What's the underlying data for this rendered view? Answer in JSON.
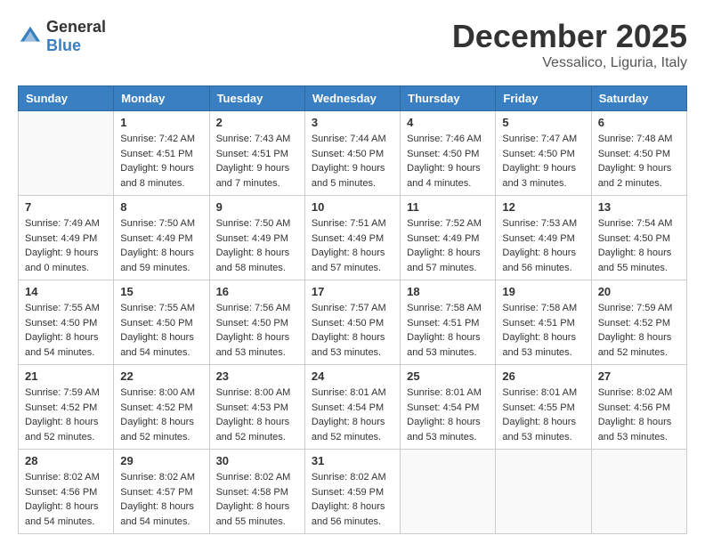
{
  "header": {
    "logo_general": "General",
    "logo_blue": "Blue",
    "month": "December 2025",
    "location": "Vessalico, Liguria, Italy"
  },
  "days_of_week": [
    "Sunday",
    "Monday",
    "Tuesday",
    "Wednesday",
    "Thursday",
    "Friday",
    "Saturday"
  ],
  "weeks": [
    [
      {
        "day": "",
        "sunrise": "",
        "sunset": "",
        "daylight": ""
      },
      {
        "day": "1",
        "sunrise": "Sunrise: 7:42 AM",
        "sunset": "Sunset: 4:51 PM",
        "daylight": "Daylight: 9 hours and 8 minutes."
      },
      {
        "day": "2",
        "sunrise": "Sunrise: 7:43 AM",
        "sunset": "Sunset: 4:51 PM",
        "daylight": "Daylight: 9 hours and 7 minutes."
      },
      {
        "day": "3",
        "sunrise": "Sunrise: 7:44 AM",
        "sunset": "Sunset: 4:50 PM",
        "daylight": "Daylight: 9 hours and 5 minutes."
      },
      {
        "day": "4",
        "sunrise": "Sunrise: 7:46 AM",
        "sunset": "Sunset: 4:50 PM",
        "daylight": "Daylight: 9 hours and 4 minutes."
      },
      {
        "day": "5",
        "sunrise": "Sunrise: 7:47 AM",
        "sunset": "Sunset: 4:50 PM",
        "daylight": "Daylight: 9 hours and 3 minutes."
      },
      {
        "day": "6",
        "sunrise": "Sunrise: 7:48 AM",
        "sunset": "Sunset: 4:50 PM",
        "daylight": "Daylight: 9 hours and 2 minutes."
      }
    ],
    [
      {
        "day": "7",
        "sunrise": "Sunrise: 7:49 AM",
        "sunset": "Sunset: 4:49 PM",
        "daylight": "Daylight: 9 hours and 0 minutes."
      },
      {
        "day": "8",
        "sunrise": "Sunrise: 7:50 AM",
        "sunset": "Sunset: 4:49 PM",
        "daylight": "Daylight: 8 hours and 59 minutes."
      },
      {
        "day": "9",
        "sunrise": "Sunrise: 7:50 AM",
        "sunset": "Sunset: 4:49 PM",
        "daylight": "Daylight: 8 hours and 58 minutes."
      },
      {
        "day": "10",
        "sunrise": "Sunrise: 7:51 AM",
        "sunset": "Sunset: 4:49 PM",
        "daylight": "Daylight: 8 hours and 57 minutes."
      },
      {
        "day": "11",
        "sunrise": "Sunrise: 7:52 AM",
        "sunset": "Sunset: 4:49 PM",
        "daylight": "Daylight: 8 hours and 57 minutes."
      },
      {
        "day": "12",
        "sunrise": "Sunrise: 7:53 AM",
        "sunset": "Sunset: 4:49 PM",
        "daylight": "Daylight: 8 hours and 56 minutes."
      },
      {
        "day": "13",
        "sunrise": "Sunrise: 7:54 AM",
        "sunset": "Sunset: 4:50 PM",
        "daylight": "Daylight: 8 hours and 55 minutes."
      }
    ],
    [
      {
        "day": "14",
        "sunrise": "Sunrise: 7:55 AM",
        "sunset": "Sunset: 4:50 PM",
        "daylight": "Daylight: 8 hours and 54 minutes."
      },
      {
        "day": "15",
        "sunrise": "Sunrise: 7:55 AM",
        "sunset": "Sunset: 4:50 PM",
        "daylight": "Daylight: 8 hours and 54 minutes."
      },
      {
        "day": "16",
        "sunrise": "Sunrise: 7:56 AM",
        "sunset": "Sunset: 4:50 PM",
        "daylight": "Daylight: 8 hours and 53 minutes."
      },
      {
        "day": "17",
        "sunrise": "Sunrise: 7:57 AM",
        "sunset": "Sunset: 4:50 PM",
        "daylight": "Daylight: 8 hours and 53 minutes."
      },
      {
        "day": "18",
        "sunrise": "Sunrise: 7:58 AM",
        "sunset": "Sunset: 4:51 PM",
        "daylight": "Daylight: 8 hours and 53 minutes."
      },
      {
        "day": "19",
        "sunrise": "Sunrise: 7:58 AM",
        "sunset": "Sunset: 4:51 PM",
        "daylight": "Daylight: 8 hours and 53 minutes."
      },
      {
        "day": "20",
        "sunrise": "Sunrise: 7:59 AM",
        "sunset": "Sunset: 4:52 PM",
        "daylight": "Daylight: 8 hours and 52 minutes."
      }
    ],
    [
      {
        "day": "21",
        "sunrise": "Sunrise: 7:59 AM",
        "sunset": "Sunset: 4:52 PM",
        "daylight": "Daylight: 8 hours and 52 minutes."
      },
      {
        "day": "22",
        "sunrise": "Sunrise: 8:00 AM",
        "sunset": "Sunset: 4:52 PM",
        "daylight": "Daylight: 8 hours and 52 minutes."
      },
      {
        "day": "23",
        "sunrise": "Sunrise: 8:00 AM",
        "sunset": "Sunset: 4:53 PM",
        "daylight": "Daylight: 8 hours and 52 minutes."
      },
      {
        "day": "24",
        "sunrise": "Sunrise: 8:01 AM",
        "sunset": "Sunset: 4:54 PM",
        "daylight": "Daylight: 8 hours and 52 minutes."
      },
      {
        "day": "25",
        "sunrise": "Sunrise: 8:01 AM",
        "sunset": "Sunset: 4:54 PM",
        "daylight": "Daylight: 8 hours and 53 minutes."
      },
      {
        "day": "26",
        "sunrise": "Sunrise: 8:01 AM",
        "sunset": "Sunset: 4:55 PM",
        "daylight": "Daylight: 8 hours and 53 minutes."
      },
      {
        "day": "27",
        "sunrise": "Sunrise: 8:02 AM",
        "sunset": "Sunset: 4:56 PM",
        "daylight": "Daylight: 8 hours and 53 minutes."
      }
    ],
    [
      {
        "day": "28",
        "sunrise": "Sunrise: 8:02 AM",
        "sunset": "Sunset: 4:56 PM",
        "daylight": "Daylight: 8 hours and 54 minutes."
      },
      {
        "day": "29",
        "sunrise": "Sunrise: 8:02 AM",
        "sunset": "Sunset: 4:57 PM",
        "daylight": "Daylight: 8 hours and 54 minutes."
      },
      {
        "day": "30",
        "sunrise": "Sunrise: 8:02 AM",
        "sunset": "Sunset: 4:58 PM",
        "daylight": "Daylight: 8 hours and 55 minutes."
      },
      {
        "day": "31",
        "sunrise": "Sunrise: 8:02 AM",
        "sunset": "Sunset: 4:59 PM",
        "daylight": "Daylight: 8 hours and 56 minutes."
      },
      {
        "day": "",
        "sunrise": "",
        "sunset": "",
        "daylight": ""
      },
      {
        "day": "",
        "sunrise": "",
        "sunset": "",
        "daylight": ""
      },
      {
        "day": "",
        "sunrise": "",
        "sunset": "",
        "daylight": ""
      }
    ]
  ]
}
